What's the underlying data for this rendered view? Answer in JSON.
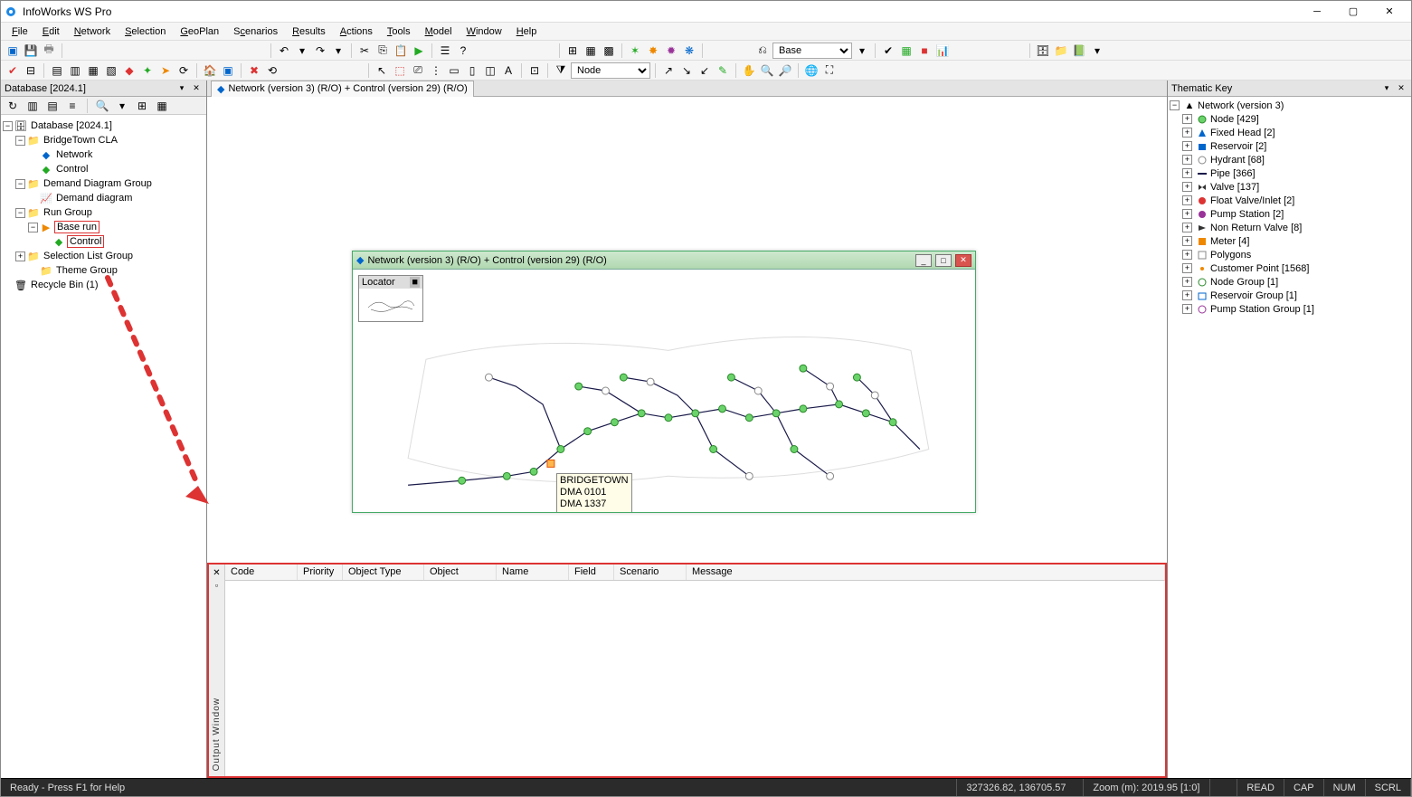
{
  "app": {
    "title": "InfoWorks WS Pro"
  },
  "menu": [
    "File",
    "Edit",
    "Network",
    "Selection",
    "GeoPlan",
    "Scenarios",
    "Results",
    "Actions",
    "Tools",
    "Model",
    "Window",
    "Help"
  ],
  "combo1": "Base",
  "combo2": "Node",
  "left_panel": {
    "title": "Database [2024.1]",
    "tree": {
      "root": "Database [2024.1]",
      "bridgetown": "BridgeTown CLA",
      "network": "Network",
      "control": "Control",
      "ddg": "Demand Diagram Group",
      "dd": "Demand diagram",
      "rg": "Run Group",
      "baserun": "Base run",
      "baserun_control": "Control",
      "slg": "Selection List Group",
      "tg": "Theme Group",
      "bin": "Recycle Bin (1)"
    }
  },
  "mdi_tab": "Network (version 3) (R/O) + Control (version 29) (R/O)",
  "child": {
    "title": "Network (version 3) (R/O) + Control (version 29) (R/O)",
    "locator": "Locator",
    "tooltip": [
      "BRIDGETOWN",
      "DMA 0101",
      "DMA 1337"
    ]
  },
  "key": {
    "title": "Thematic Key",
    "root": "Network (version 3)",
    "items": [
      {
        "sym": "node",
        "label": "Node [429]"
      },
      {
        "sym": "fixedhead",
        "label": "Fixed Head [2]"
      },
      {
        "sym": "reservoir",
        "label": "Reservoir [2]"
      },
      {
        "sym": "hydrant",
        "label": "Hydrant [68]"
      },
      {
        "sym": "pipe",
        "label": "Pipe [366]"
      },
      {
        "sym": "valve",
        "label": "Valve [137]"
      },
      {
        "sym": "floatvalve",
        "label": "Float Valve/Inlet [2]"
      },
      {
        "sym": "pumpstation",
        "label": "Pump Station [2]"
      },
      {
        "sym": "nrv",
        "label": "Non Return Valve [8]"
      },
      {
        "sym": "meter",
        "label": "Meter [4]"
      },
      {
        "sym": "polygons",
        "label": "Polygons"
      },
      {
        "sym": "customer",
        "label": "Customer Point [1568]"
      },
      {
        "sym": "nodegroup",
        "label": "Node Group [1]"
      },
      {
        "sym": "resgroup",
        "label": "Reservoir Group [1]"
      },
      {
        "sym": "psgroup",
        "label": "Pump Station Group [1]"
      }
    ]
  },
  "output": {
    "label": "Output Window",
    "columns": [
      "Code",
      "Priority",
      "Object Type",
      "Object",
      "Name",
      "Field",
      "Scenario",
      "Message"
    ]
  },
  "status": {
    "ready": "Ready - Press F1 for Help",
    "coords": "327326.82, 136705.57",
    "zoom": "Zoom (m): 2019.95 [1:0]",
    "flags": [
      "READ",
      "CAP",
      "NUM",
      "SCRL"
    ]
  }
}
